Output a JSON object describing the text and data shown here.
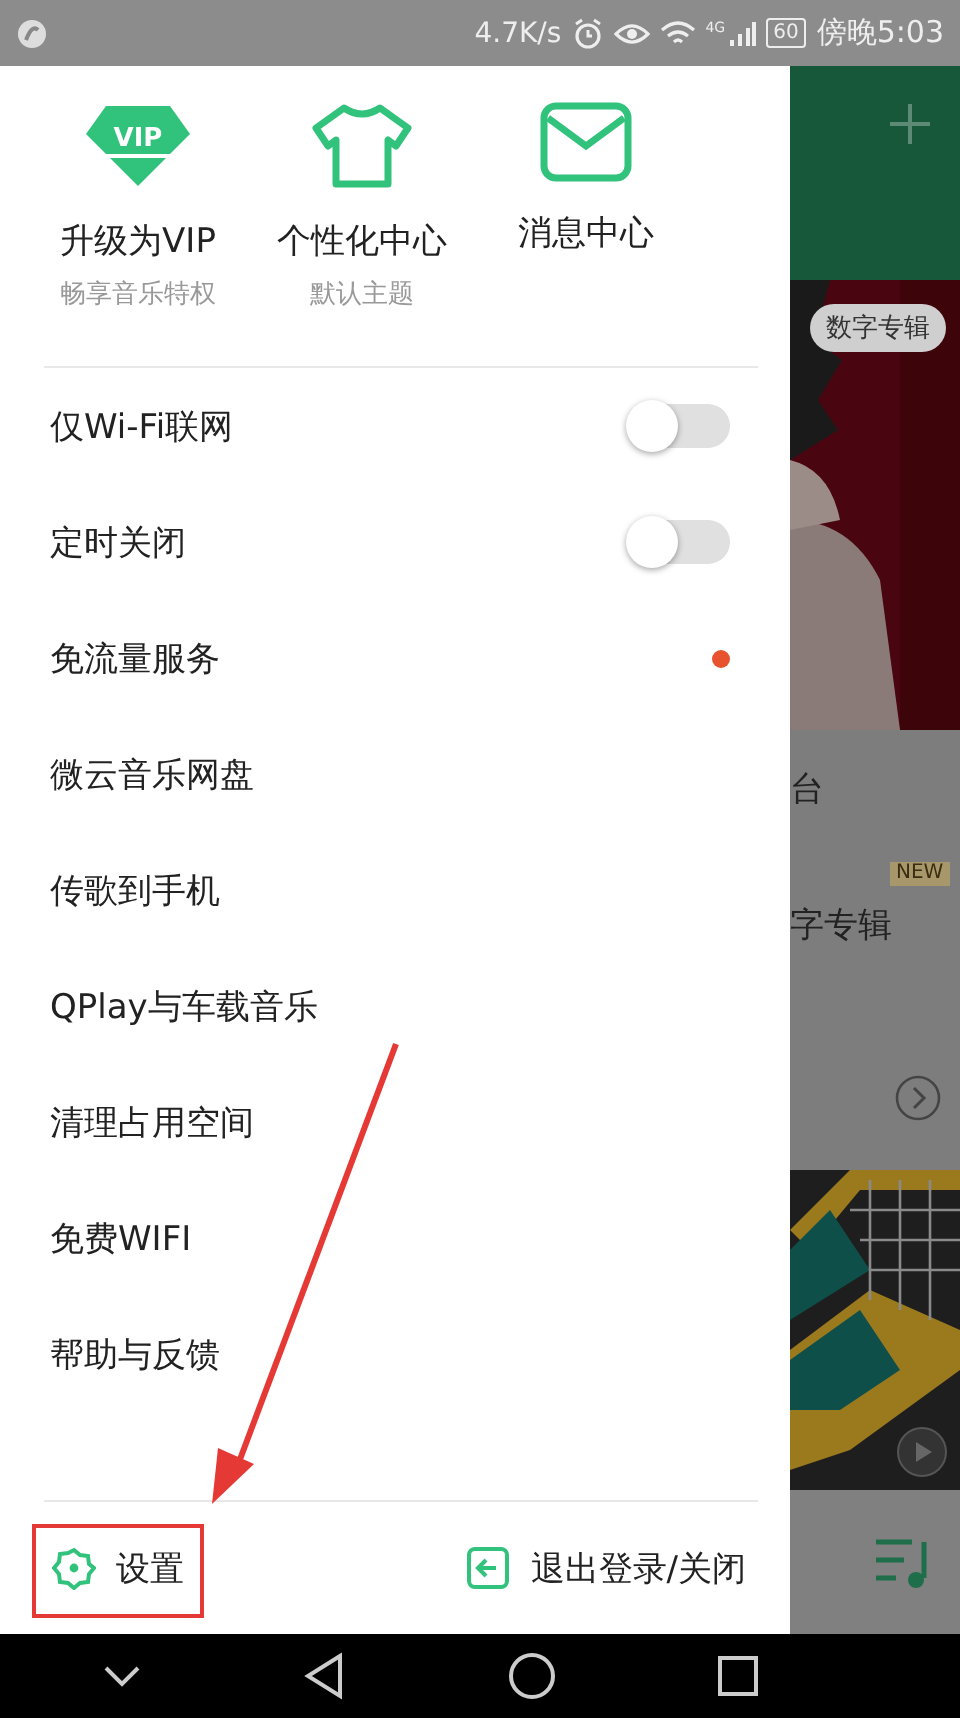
{
  "status_bar": {
    "speed": "4.7K/s",
    "network": "4G",
    "battery": "60",
    "time": "傍晚5:03"
  },
  "drawer": {
    "shortcuts": [
      {
        "kind": "vip",
        "title": "升级为VIP",
        "subtitle": "畅享音乐特权",
        "badge": "VIP"
      },
      {
        "kind": "theme",
        "title": "个性化中心",
        "subtitle": "默认主题"
      },
      {
        "kind": "message",
        "title": "消息中心"
      }
    ],
    "menu": [
      {
        "label": "仅Wi-Fi联网",
        "kind": "toggle",
        "on": false
      },
      {
        "label": "定时关闭",
        "kind": "toggle",
        "on": false
      },
      {
        "label": "免流量服务",
        "kind": "dot",
        "color": "#e8532f"
      },
      {
        "label": "微云音乐网盘",
        "kind": "plain"
      },
      {
        "label": "传歌到手机",
        "kind": "plain"
      },
      {
        "label": "QPlay与车载音乐",
        "kind": "plain"
      },
      {
        "label": "清理占用空间",
        "kind": "plain"
      },
      {
        "label": "免费WIFI",
        "kind": "plain"
      },
      {
        "label": "帮助与反馈",
        "kind": "plain"
      }
    ],
    "footer": {
      "settings": "设置",
      "logout": "退出登录/关闭"
    }
  },
  "background": {
    "banner_tag": "数字专辑",
    "items": [
      {
        "label": "台"
      },
      {
        "label": "字专辑",
        "badge": "NEW"
      }
    ]
  }
}
